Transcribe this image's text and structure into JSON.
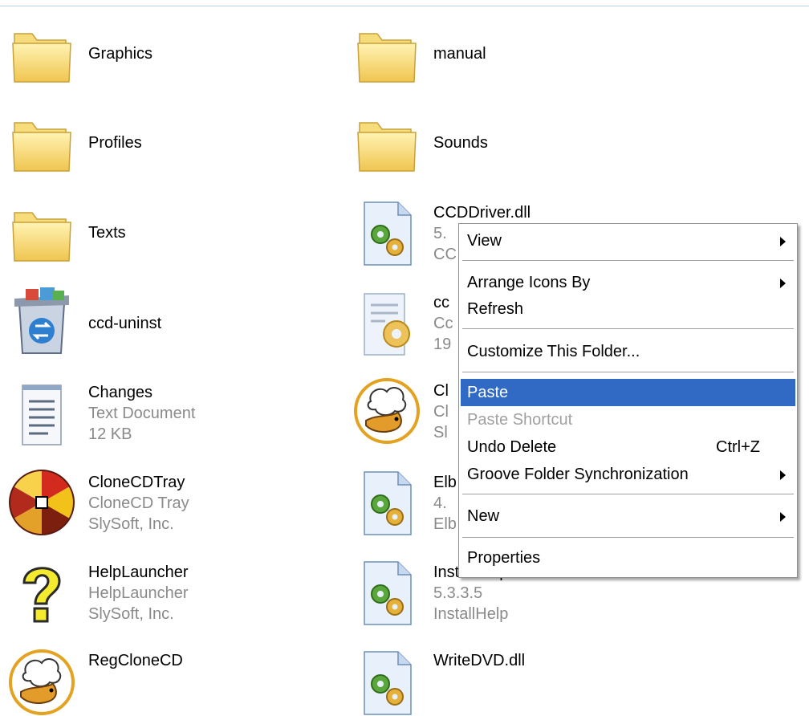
{
  "files": [
    {
      "name": "Graphics",
      "sub1": "",
      "sub2": "",
      "icon": "folder-icon"
    },
    {
      "name": "Profiles",
      "sub1": "",
      "sub2": "",
      "icon": "folder-icon"
    },
    {
      "name": "Texts",
      "sub1": "",
      "sub2": "",
      "icon": "folder-icon"
    },
    {
      "name": "ccd-uninst",
      "sub1": "",
      "sub2": "",
      "icon": "uninstall-icon"
    },
    {
      "name": "Changes",
      "sub1": "Text Document",
      "sub2": "12 KB",
      "icon": "text-document-icon"
    },
    {
      "name": "CloneCDTray",
      "sub1": "CloneCD Tray",
      "sub2": "SlySoft, Inc.",
      "icon": "clonecd-tray-icon"
    },
    {
      "name": "HelpLauncher",
      "sub1": "HelpLauncher",
      "sub2": "SlySoft, Inc.",
      "icon": "help-icon"
    },
    {
      "name": "RegCloneCD",
      "sub1": "",
      "sub2": "",
      "icon": "sheep-icon"
    },
    {
      "name": "manual",
      "sub1": "",
      "sub2": "",
      "icon": "folder-icon"
    },
    {
      "name": "Sounds",
      "sub1": "",
      "sub2": "",
      "icon": "folder-icon"
    },
    {
      "name": "CCDDriver.dll",
      "sub1": "5.",
      "sub2": "CC",
      "icon": "dll-icon"
    },
    {
      "name": "cc",
      "sub1": "Cc",
      "sub2": "19",
      "icon": "config-file-icon"
    },
    {
      "name": "Cl",
      "sub1": "Cl",
      "sub2": "Sl",
      "icon": "sheep-icon"
    },
    {
      "name": "Elb",
      "sub1": "4.",
      "sub2": "Elb",
      "icon": "dll-icon"
    },
    {
      "name": "InstallHelp.dll",
      "sub1": "5.3.3.5",
      "sub2": "InstallHelp",
      "icon": "dll-icon"
    },
    {
      "name": "WriteDVD.dll",
      "sub1": "",
      "sub2": "",
      "icon": "dll-icon"
    }
  ],
  "menu": {
    "view": "View",
    "arrange": "Arrange Icons By",
    "refresh": "Refresh",
    "customize": "Customize This Folder...",
    "paste": "Paste",
    "paste_shortcut": "Paste Shortcut",
    "undo_delete": "Undo Delete",
    "undo_shortcut": "Ctrl+Z",
    "groove": "Groove Folder Synchronization",
    "new": "New",
    "properties": "Properties"
  },
  "colors": {
    "highlight": "#316ac5",
    "disabled_text": "#a0a0a0",
    "secondary_text": "#8a8a8a"
  }
}
